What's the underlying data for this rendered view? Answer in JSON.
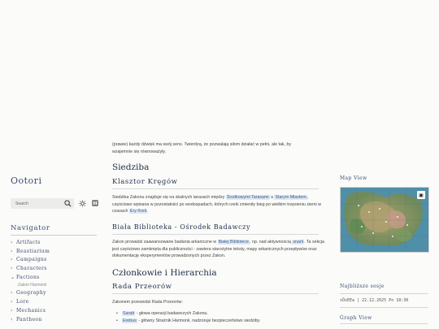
{
  "sidebar": {
    "site_title": "Ootori",
    "search_placeholder": "Search",
    "navigator_heading": "Navigator",
    "nav_items": [
      {
        "label": "Artifacts",
        "expanded": false
      },
      {
        "label": "Beastiarium",
        "expanded": false
      },
      {
        "label": "Campaigns",
        "expanded": false
      },
      {
        "label": "Characters",
        "expanded": false
      },
      {
        "label": "Factions",
        "expanded": true
      },
      {
        "label": "Zakon Harmonii",
        "sub": true
      },
      {
        "label": "Geography",
        "expanded": false
      },
      {
        "label": "Lore",
        "expanded": false
      },
      {
        "label": "Mechanics",
        "expanded": false
      },
      {
        "label": "Pantheon",
        "expanded": false
      }
    ]
  },
  "content": {
    "intro_line1": "(prawie) każdy dźwięk ma swój sens. Twierdzą, że pozwalają siłom działać w pełni, ale tak, by",
    "intro_line2": "wzajemnie się równoważyły.",
    "siedziba_heading": "Siedziba",
    "klasztor_heading": "Klasztor Kręgów",
    "klasztor_text_1": "Siedziba Zakonu znajduje się na skalnych tarasach między ",
    "klasztor_link_1": "Środkowymi Tarasami",
    "klasztor_text_2": " a ",
    "klasztor_link_2": "Starym Miastem",
    "klasztor_text_3": ", częściowo wpisana w pozostałości po wodospadach, których rzeki zmieniły bieg po wielkim trzęsieniu ziemi w czasach ",
    "klasztor_link_3": "Ery Kreli",
    "klasztor_text_4": ".",
    "biblioteka_heading": "Biała Biblioteka - Ośrodek Badawczy",
    "biblioteka_text_1": "Zakon prowadzi zaawansowane badania arkaniczne w ",
    "biblioteka_link_1": "Białej Bibliotece",
    "biblioteka_text_2": ", np. nad aktywnością ",
    "biblioteka_link_2": "snarli",
    "biblioteka_text_3": ". Ta sekcja jest częściowo zamknięta dla publiczności - zawiera starożytne teksty, mapy arkanicznych przepływów oraz dokumentację eksperymentów prowadzonych przez Zakon.",
    "czlonkowie_heading": "Członkowie i Hierarchia",
    "rada_heading": "Rada Przeorów",
    "rada_intro": "Zakonem przewodzi Rada Przeorów:",
    "members": [
      {
        "name": "Saratt",
        "desc": " - głowa operacji badawczych Zakonu."
      },
      {
        "name": "Erebus",
        "desc": " - główny Strażnik Harmonii, nadzoruje bezpieczeństwo siedziby."
      }
    ]
  },
  "right_sidebar": {
    "map_view_title": "Map View",
    "recent_title": "Najbliższe sesje",
    "recent_row": "sÖsEEa | 22.12.2025 Pn 18:30",
    "graph_view_title": "Graph View"
  }
}
